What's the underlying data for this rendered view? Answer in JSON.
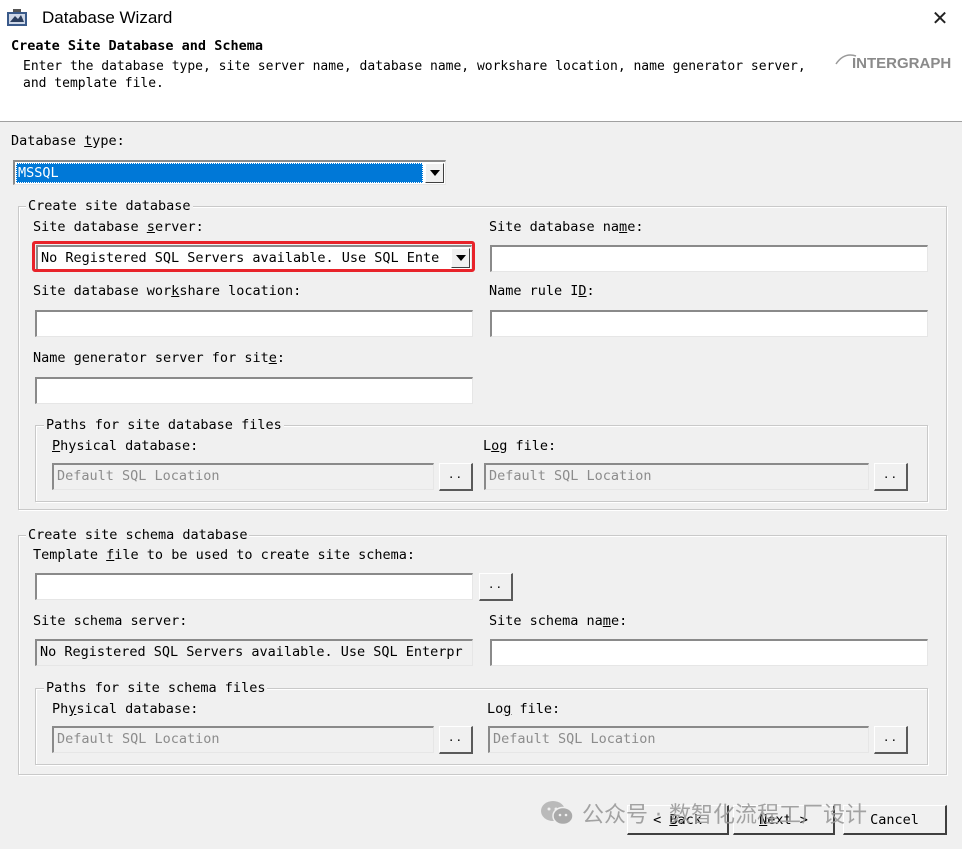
{
  "window": {
    "title": "Database Wizard",
    "close_glyph": "✕"
  },
  "header": {
    "title": "Create Site Database and Schema",
    "description": "Enter the database type, site server name, database name, workshare location, name generator server, and template file.",
    "logo_text": "INTERGRAPH"
  },
  "database_type": {
    "label_pre": "Database ",
    "label_u": "t",
    "label_post": "ype:",
    "value": "MSSQL"
  },
  "site_db_group": {
    "legend": "Create site database",
    "server_label": {
      "pre": "Site database ",
      "u": "s",
      "post": "erver:"
    },
    "server_value": "No Registered SQL Servers available. Use SQL Ente",
    "name_label": {
      "pre": "Site database na",
      "u": "m",
      "post": "e:"
    },
    "name_value": "",
    "workshare_label": {
      "pre": "Site database wor",
      "u": "k",
      "post": "share location:"
    },
    "workshare_value": "",
    "name_rule_label": {
      "pre": "Name rule I",
      "u": "D",
      "post": ":"
    },
    "name_rule_value": "",
    "namegen_label": {
      "pre": "Name generator server for sit",
      "u": "e",
      "post": ":"
    },
    "namegen_value": "",
    "paths_legend": "Paths for site database files",
    "physical_label": {
      "pre": "",
      "u": "P",
      "post": "hysical database:"
    },
    "physical_value": "Default SQL Location",
    "log_label": {
      "pre": "L",
      "u": "o",
      "post": "g file:"
    },
    "log_value": "Default SQL Location"
  },
  "schema_group": {
    "legend": "Create site schema database",
    "template_label": {
      "pre": "Template ",
      "u": "f",
      "post": "ile to be used to create site schema:"
    },
    "template_value": "",
    "server_label": "Site schema server:",
    "server_value": "No Registered SQL Servers available. Use SQL Enterpr",
    "name_label": {
      "pre": "Site schema na",
      "u": "m",
      "post": "e:"
    },
    "name_value": "",
    "paths_legend": "Paths for site schema files",
    "physical_label": {
      "pre": "Ph",
      "u": "y",
      "post": "sical database:"
    },
    "physical_value": "Default SQL Location",
    "log_label": {
      "pre": "Lo",
      "u": "g",
      "post": " file:"
    },
    "log_value": "Default SQL Location"
  },
  "browse_label": "..",
  "footer": {
    "back": {
      "pre": "< ",
      "u": "B",
      "post": "ack"
    },
    "next": {
      "pre": "",
      "u": "N",
      "post": "ext >"
    },
    "cancel": "Cancel"
  },
  "watermark": "公众号 · 数智化流程工厂设计",
  "colors": {
    "selection": "#0078d7",
    "highlight_border": "#e8232a"
  }
}
